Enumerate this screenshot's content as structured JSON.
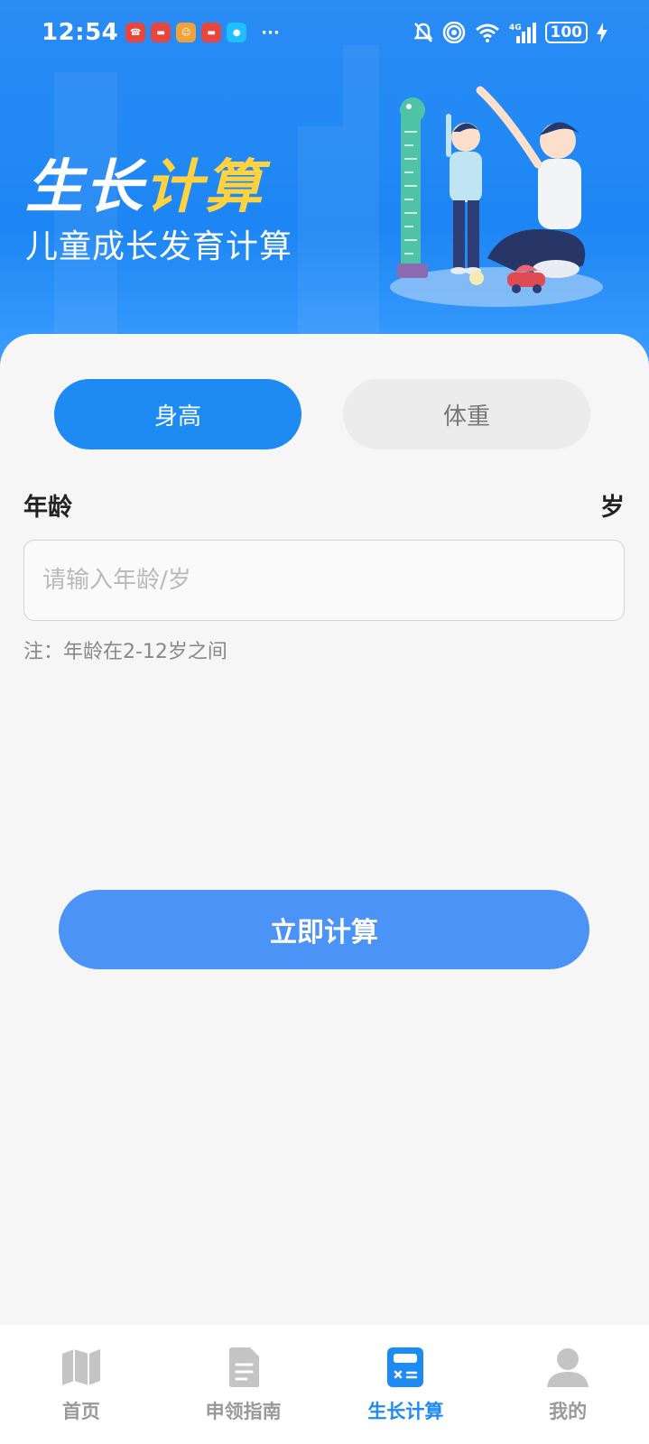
{
  "status_bar": {
    "time": "12:54",
    "battery": "100",
    "network": "4G"
  },
  "hero": {
    "title_white": "生长",
    "title_yellow": "计算",
    "subtitle": "儿童成长发育计算"
  },
  "tabs": [
    {
      "label": "身高",
      "active": true
    },
    {
      "label": "体重",
      "active": false
    }
  ],
  "form": {
    "age_label": "年龄",
    "age_unit": "岁",
    "age_placeholder": "请输入年龄/岁",
    "note": "注：年龄在2-12岁之间",
    "submit_label": "立即计算"
  },
  "bottom_nav": [
    {
      "label": "首页",
      "icon": "map-icon",
      "active": false
    },
    {
      "label": "申领指南",
      "icon": "document-icon",
      "active": false
    },
    {
      "label": "生长计算",
      "icon": "calculator-icon",
      "active": true
    },
    {
      "label": "我的",
      "icon": "person-icon",
      "active": false
    }
  ],
  "colors": {
    "primary": "#1e8bf3",
    "button": "#4b93f7",
    "accent_yellow": "#ffd23f"
  }
}
